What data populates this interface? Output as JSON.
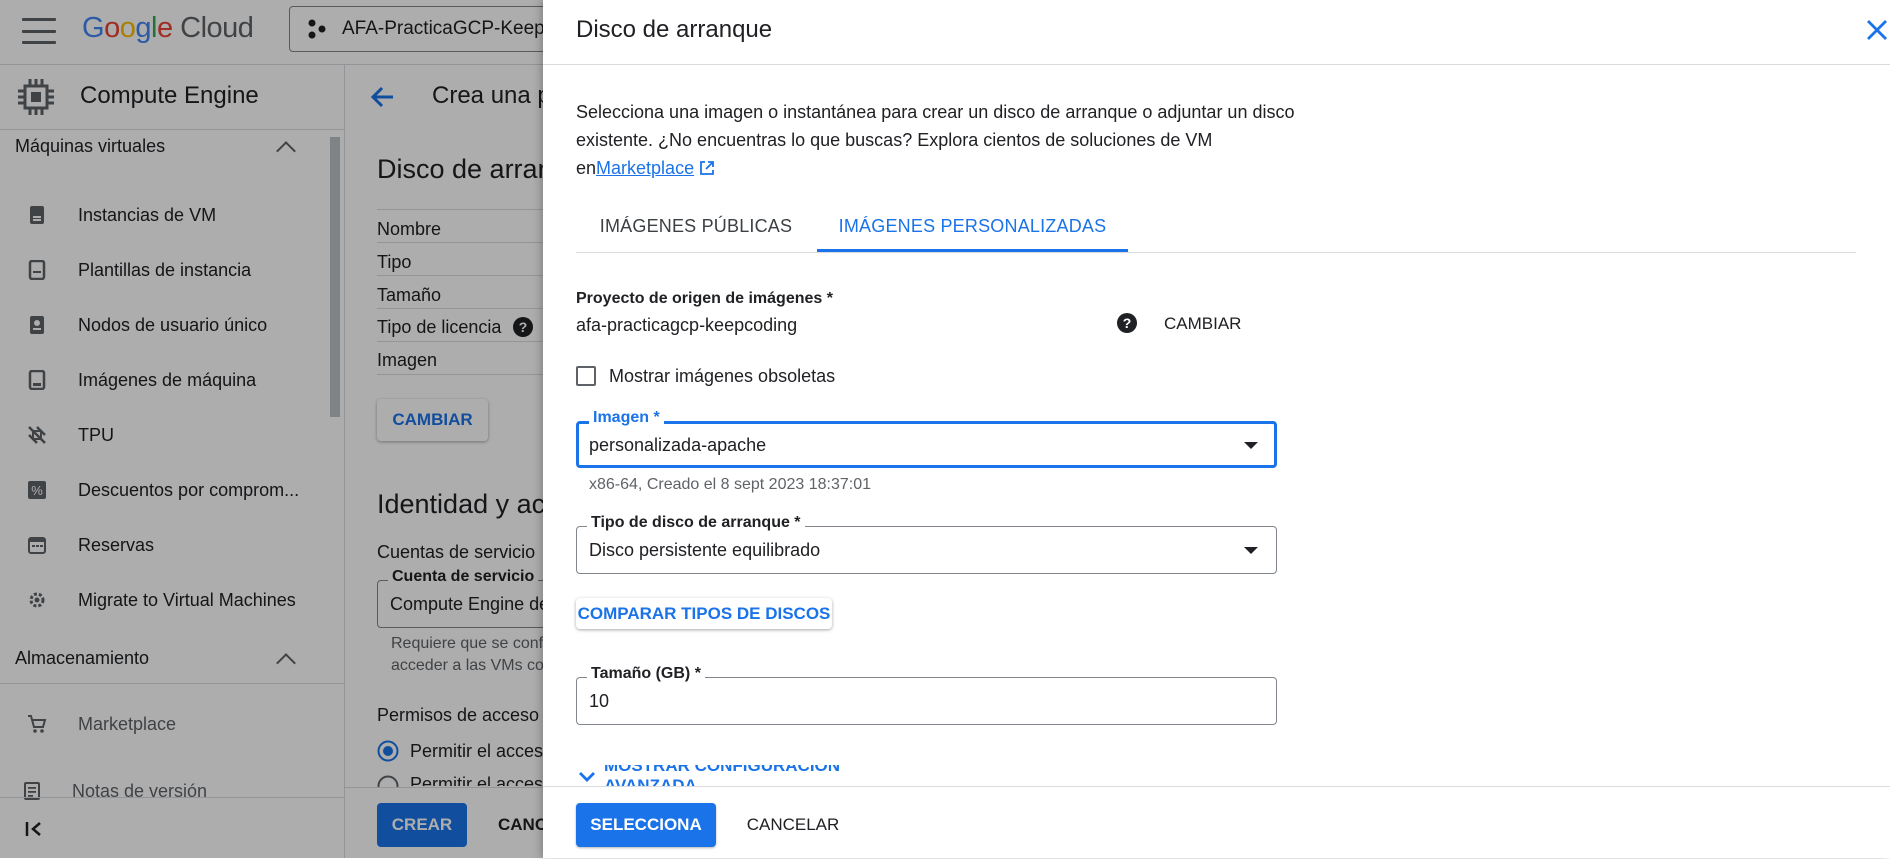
{
  "topbar": {
    "logo_google": [
      "G",
      "o",
      "o",
      "g",
      "l",
      "e"
    ],
    "logo_cloud": "Cloud",
    "project_name": "AFA-PracticaGCP-KeepC"
  },
  "sidebar": {
    "title": "Compute Engine",
    "section_vm": "Máquinas virtuales",
    "items": [
      {
        "label": "Instancias de VM",
        "icon": "vm-instance-icon"
      },
      {
        "label": "Plantillas de instancia",
        "icon": "instance-template-icon"
      },
      {
        "label": "Nodos de usuario único",
        "icon": "sole-tenant-node-icon"
      },
      {
        "label": "Imágenes de máquina",
        "icon": "machine-image-icon"
      },
      {
        "label": "TPU",
        "icon": "tpu-icon"
      },
      {
        "label": "Descuentos por comprom...",
        "icon": "discount-icon"
      },
      {
        "label": "Reservas",
        "icon": "calendar-icon"
      },
      {
        "label": "Migrate to Virtual Machines",
        "icon": "migrate-icon"
      }
    ],
    "section_storage": "Almacenamiento",
    "marketplace": "Marketplace",
    "release_notes": "Notas de versión",
    "collapse_icon": "collapse-sidebar-icon"
  },
  "main": {
    "page_title": "Crea una p",
    "boot_disk_heading": "Disco de arran",
    "rows": [
      "Nombre",
      "Tipo",
      "Tamaño",
      "Tipo de licencia",
      "Imagen"
    ],
    "change_button": "CAMBIAR",
    "identity_heading": "Identidad y ac",
    "service_accounts_label": "Cuentas de servicio",
    "service_account_field_label": "Cuenta de servicio",
    "service_account_value": "Compute Engine de",
    "service_account_hint_1": "Requiere que se conf",
    "service_account_hint_2": "acceder a las VMs co",
    "access_scopes_label": "Permisos de acceso",
    "radio_1": "Permitir el acces",
    "radio_2": "Permitir el acces",
    "create_button": "CREAR",
    "cancel_button": "CANC"
  },
  "panel": {
    "title": "Disco de arranque",
    "description_1": "Selecciona una imagen o instantánea para crear un disco de arranque o adjuntar un disco existente. ¿No encuentras lo que buscas? Explora cientos de soluciones de VM en",
    "marketplace_link": "Marketplace",
    "tabs": [
      {
        "label": "IMÁGENES PÚBLICAS",
        "active": false
      },
      {
        "label": "IMÁGENES PERSONALIZADAS",
        "active": true
      }
    ],
    "source_project_label": "Proyecto de origen de imágenes *",
    "source_project_value": "afa-practicagcp-keepcoding",
    "change_button": "CAMBIAR",
    "show_deprecated_label": "Mostrar imágenes obsoletas",
    "show_deprecated_checked": false,
    "image_field_label": "Imagen *",
    "image_field_value": "personalizada-apache",
    "image_hint": "x86-64, Creado el 8 sept 2023 18:37:01",
    "disk_type_label": "Tipo de disco de arranque *",
    "disk_type_value": "Disco persistente equilibrado",
    "compare_button": "COMPARAR TIPOS DE DISCOS",
    "size_label": "Tamaño (GB) *",
    "size_value": "10",
    "advanced_toggle": "MOSTRAR CONFIGURACIÓN AVANZADA",
    "select_button": "SELECCIONA",
    "cancel_button": "CANCELAR"
  },
  "colors": {
    "accent": "#1a73e8",
    "text": "#202124",
    "muted": "#5f6368",
    "scrim": "rgba(0,0,0,0.32)"
  }
}
